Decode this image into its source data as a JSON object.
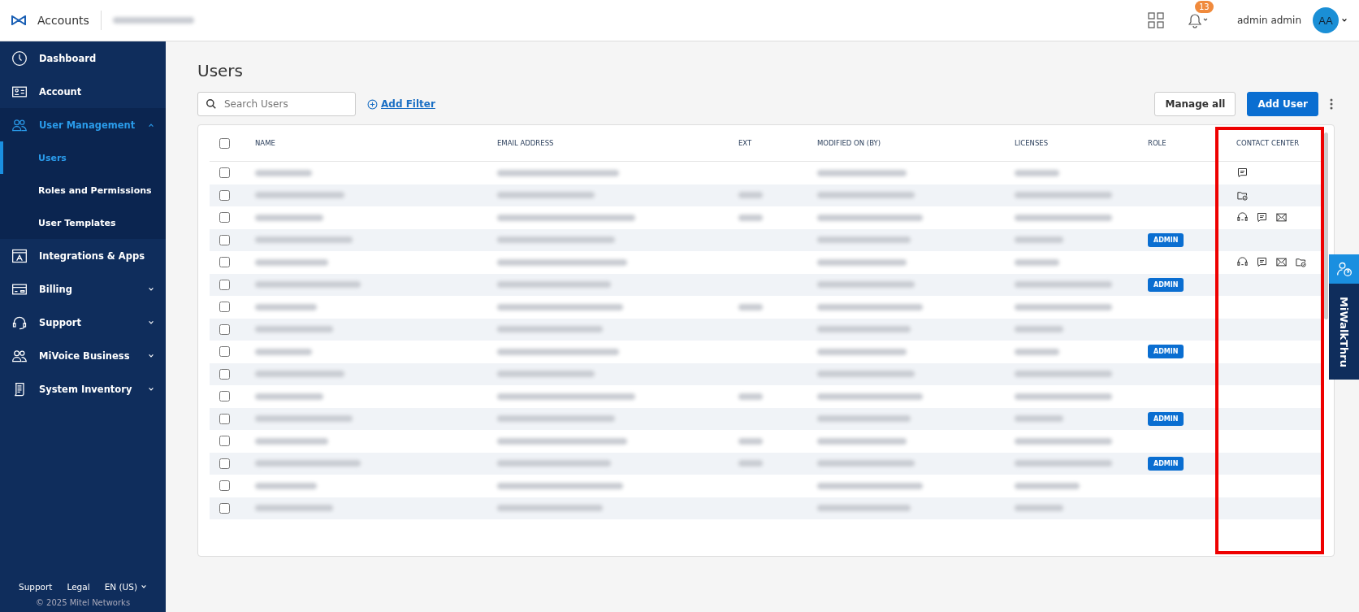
{
  "header": {
    "app_name": "Accounts",
    "user_name": "admin admin",
    "avatar_initials": "AA",
    "notification_count": "13"
  },
  "sidebar": {
    "items": [
      {
        "label": "Dashboard",
        "expandable": false,
        "expanded": false,
        "selected": false
      },
      {
        "label": "Account",
        "expandable": false,
        "expanded": false,
        "selected": false
      },
      {
        "label": "User Management",
        "expandable": true,
        "expanded": true,
        "selected": true,
        "children": [
          {
            "label": "Users",
            "selected": true
          },
          {
            "label": "Roles and Permissions",
            "selected": false
          },
          {
            "label": "User Templates",
            "selected": false
          }
        ]
      },
      {
        "label": "Integrations & Apps",
        "expandable": false,
        "expanded": false,
        "selected": false
      },
      {
        "label": "Billing",
        "expandable": true,
        "expanded": false,
        "selected": false
      },
      {
        "label": "Support",
        "expandable": true,
        "expanded": false,
        "selected": false
      },
      {
        "label": "MiVoice Business",
        "expandable": true,
        "expanded": false,
        "selected": false
      },
      {
        "label": "System Inventory",
        "expandable": true,
        "expanded": false,
        "selected": false
      }
    ],
    "footer_links": [
      "Support",
      "Legal",
      "EN (US)"
    ],
    "copyright": "© 2025 Mitel Networks"
  },
  "page": {
    "title": "Users",
    "search": {
      "placeholder": "Search Users"
    },
    "add_filter": "Add Filter",
    "buttons": [
      {
        "label": "Manage all",
        "kind": "secondary"
      },
      {
        "label": "Add User",
        "kind": "primary"
      }
    ]
  },
  "table": {
    "select_all_checked": false,
    "columns": [
      {
        "label": "NAME",
        "highlighted": false
      },
      {
        "label": "EMAIL ADDRESS",
        "highlighted": false
      },
      {
        "label": "EXT",
        "highlighted": false
      },
      {
        "label": "MODIFIED ON (BY)",
        "highlighted": false
      },
      {
        "label": "LICENSES",
        "highlighted": false
      },
      {
        "label": "ROLE",
        "highlighted": false
      },
      {
        "label": "CONTACT CENTER",
        "highlighted": true
      }
    ],
    "rows": [
      {
        "checked": false,
        "has_ext": false,
        "role": null,
        "voice": false,
        "chat": true,
        "email": false,
        "workflow": false
      },
      {
        "checked": false,
        "has_ext": true,
        "role": null,
        "voice": false,
        "chat": false,
        "email": false,
        "workflow": true
      },
      {
        "checked": false,
        "has_ext": true,
        "role": null,
        "voice": true,
        "chat": true,
        "email": true,
        "workflow": false
      },
      {
        "checked": false,
        "has_ext": false,
        "role": "ADMIN",
        "voice": false,
        "chat": false,
        "email": false,
        "workflow": false
      },
      {
        "checked": false,
        "has_ext": false,
        "role": null,
        "voice": true,
        "chat": true,
        "email": true,
        "workflow": true
      },
      {
        "checked": false,
        "has_ext": false,
        "role": "ADMIN",
        "voice": false,
        "chat": false,
        "email": false,
        "workflow": false
      },
      {
        "checked": false,
        "has_ext": true,
        "role": null,
        "voice": false,
        "chat": false,
        "email": false,
        "workflow": false
      },
      {
        "checked": false,
        "has_ext": false,
        "role": null,
        "voice": false,
        "chat": false,
        "email": false,
        "workflow": false
      },
      {
        "checked": false,
        "has_ext": false,
        "role": "ADMIN",
        "voice": false,
        "chat": false,
        "email": false,
        "workflow": false
      },
      {
        "checked": false,
        "has_ext": false,
        "role": null,
        "voice": false,
        "chat": false,
        "email": false,
        "workflow": false
      },
      {
        "checked": false,
        "has_ext": true,
        "role": null,
        "voice": false,
        "chat": false,
        "email": false,
        "workflow": false
      },
      {
        "checked": false,
        "has_ext": false,
        "role": "ADMIN",
        "voice": false,
        "chat": false,
        "email": false,
        "workflow": false
      },
      {
        "checked": false,
        "has_ext": true,
        "role": null,
        "voice": false,
        "chat": false,
        "email": false,
        "workflow": false
      },
      {
        "checked": false,
        "has_ext": true,
        "role": "ADMIN",
        "voice": false,
        "chat": false,
        "email": false,
        "workflow": false
      },
      {
        "checked": false,
        "has_ext": false,
        "role": null,
        "voice": false,
        "chat": false,
        "email": false,
        "workflow": false
      },
      {
        "checked": false,
        "has_ext": false,
        "role": null,
        "voice": false,
        "chat": false,
        "email": false,
        "workflow": false
      }
    ]
  },
  "help_tab": {
    "label": "MiWalkThru"
  }
}
